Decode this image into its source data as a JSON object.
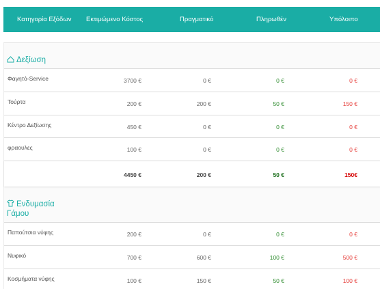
{
  "header": {
    "category": "Κατηγορία Εξόδων",
    "estimated": "Εκτιμώμενο Κόστος",
    "actual": "Πραγματικό",
    "paid": "Πληρωθέν",
    "remaining": "Υπόλοιπο"
  },
  "colors": {
    "accent": "#1aada5",
    "paid": "#2e8b2e",
    "remaining": "#e53935"
  },
  "sections": [
    {
      "title": "Δεξίωση",
      "icon": "house-outline-icon",
      "rows": [
        {
          "name": "Φαγητό-Service",
          "estimated": "3700 €",
          "actual": "0 €",
          "paid": "0 €",
          "remaining": "0 €"
        },
        {
          "name": "Τούρτα",
          "estimated": "200 €",
          "actual": "200 €",
          "paid": "50 €",
          "remaining": "150 €"
        },
        {
          "name": "Κέντρο Δεξίωσης",
          "estimated": "450 €",
          "actual": "0 €",
          "paid": "0 €",
          "remaining": "0 €"
        },
        {
          "name": "φραουλες",
          "estimated": "100 €",
          "actual": "0 €",
          "paid": "0 €",
          "remaining": "0 €"
        }
      ],
      "total": {
        "estimated": "4450 €",
        "actual": "200 €",
        "paid": "50 €",
        "remaining": "150€"
      }
    },
    {
      "title_line1": "Ενδυμασία",
      "title_line2": "Γάμου",
      "icon": "shirt-icon",
      "rows": [
        {
          "name": "Παπούτσια νύφης",
          "estimated": "200 €",
          "actual": "0 €",
          "paid": "0 €",
          "remaining": "0 €"
        },
        {
          "name": "Νυφικό",
          "estimated": "700 €",
          "actual": "600 €",
          "paid": "100 €",
          "remaining": "500 €"
        },
        {
          "name": "Κοσμήματα νύφης",
          "estimated": "100 €",
          "actual": "150 €",
          "paid": "50 €",
          "remaining": "100 €"
        }
      ]
    }
  ]
}
